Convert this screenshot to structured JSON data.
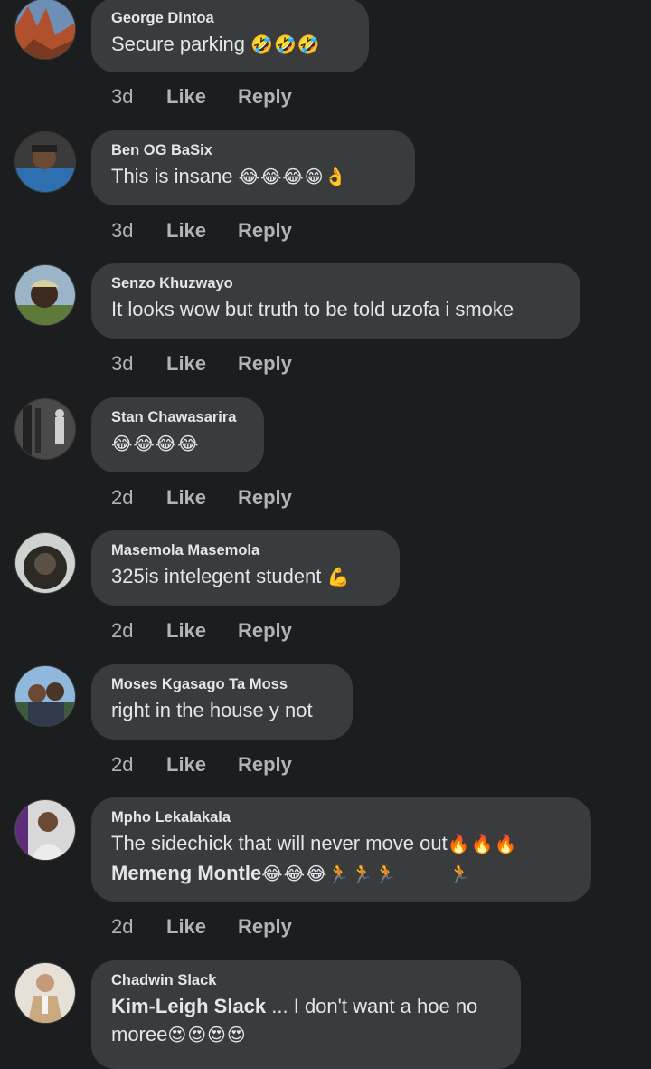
{
  "comments": [
    {
      "author": "George Dintoa",
      "text": "Secure parking",
      "emoji": "🤣🤣🤣",
      "age": "3d",
      "like": "Like",
      "reply": "Reply"
    },
    {
      "author": "Ben OG BaSix",
      "text": "This is insane",
      "emoji": "😂😂😂😁👌",
      "age": "3d",
      "like": "Like",
      "reply": "Reply"
    },
    {
      "author": "Senzo Khuzwayo",
      "text": "It looks wow but truth to be told uzofa i smoke",
      "emoji": "",
      "age": "3d",
      "like": "Like",
      "reply": "Reply"
    },
    {
      "author": "Stan Chawasarira",
      "text": "",
      "emoji": "😂😂😂😂",
      "age": "2d",
      "like": "Like",
      "reply": "Reply"
    },
    {
      "author": "Masemola Masemola",
      "text": "325is intelegent student",
      "emoji": "💪",
      "age": "2d",
      "like": "Like",
      "reply": "Reply"
    },
    {
      "author": "Moses Kgasago Ta Moss",
      "text": "right in the house y not",
      "emoji": "",
      "age": "2d",
      "like": "Like",
      "reply": "Reply"
    },
    {
      "author": "Mpho Lekalakala",
      "text": "The sidechick that will never move out",
      "emoji": "🔥🔥🔥",
      "mention": "Memeng Montle",
      "emoji2": "😂😂😂🏃🏃🏃",
      "emoji3": "🏃",
      "age": "2d",
      "like": "Like",
      "reply": "Reply"
    },
    {
      "author": "Chadwin Slack",
      "mention": "Kim-Leigh Slack",
      "text": " ... I don't want a hoe no",
      "text2": "moree",
      "emoji": "😍😍😍😍"
    }
  ],
  "colors": {
    "background": "#1c1d1f",
    "bubble": "#3a3b3c",
    "text": "#e4e6eb",
    "meta": "#b0b3b8"
  }
}
